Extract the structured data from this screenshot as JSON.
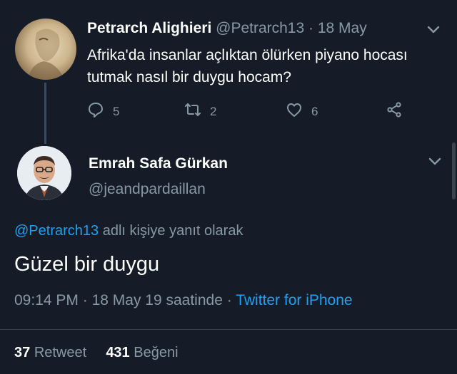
{
  "parent_tweet": {
    "name": "Petrarch Alighieri",
    "handle": "@Petrarch13",
    "separator": "·",
    "date": "18 May",
    "text": "Afrika'da insanlar açlıktan ölürken piyano hocası tutmak nasıl bir duygu hocam?",
    "actions": {
      "reply_count": "5",
      "retweet_count": "2",
      "like_count": "6"
    }
  },
  "reply_tweet": {
    "name": "Emrah Safa Gürkan",
    "handle": "@jeandpardaillan",
    "replying_to_mention": "@Petrarch13",
    "replying_to_suffix": " adlı kişiye yanıt olarak",
    "text": "Güzel bir duygu",
    "time": "09:14 PM",
    "date_text": "18 May 19 saatinde",
    "client": "Twitter for iPhone",
    "stats": {
      "retweets_count": "37",
      "retweets_label": "Retweet",
      "likes_count": "431",
      "likes_label": "Beğeni"
    }
  },
  "colors": {
    "background": "#151c27",
    "secondary_text": "#8899a6",
    "link": "#1da1f2"
  },
  "icons": [
    "reply-icon",
    "retweet-icon",
    "like-icon",
    "share-icon",
    "chevron-down-icon"
  ]
}
